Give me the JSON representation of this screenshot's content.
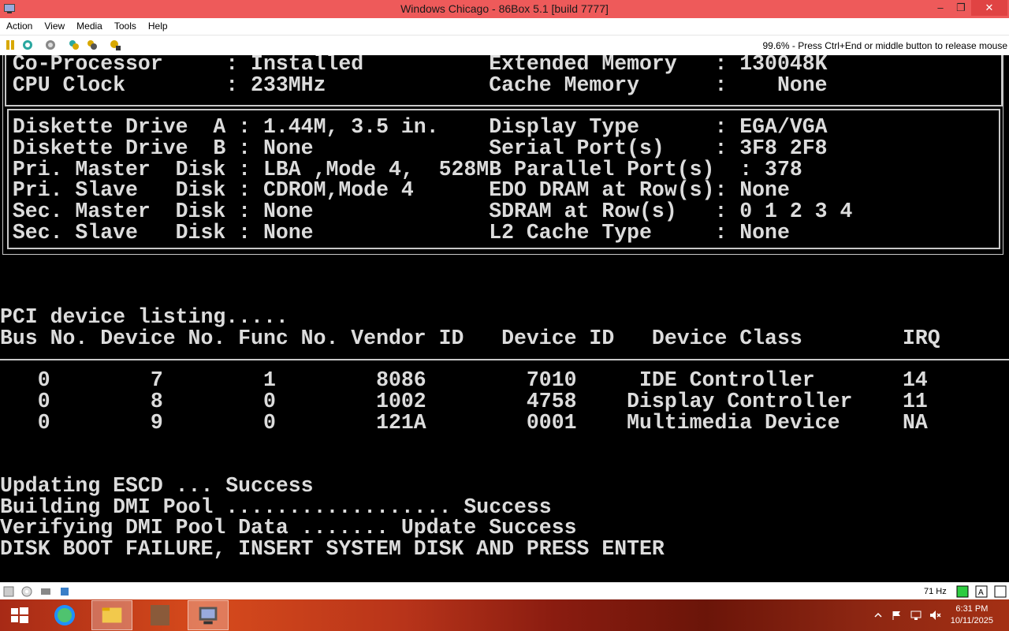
{
  "window": {
    "title": "Windows Chicago - 86Box 5.1 [build 7777]",
    "minimize": "–",
    "restore": "❐",
    "close": "✕"
  },
  "menu": {
    "items": [
      "Action",
      "View",
      "Media",
      "Tools",
      "Help"
    ]
  },
  "toolbar": {
    "buttons": [
      "pause-icon",
      "reset-icon",
      "ctrl-alt-del-icon",
      "settings-icon",
      "hard-reset-icon",
      "screenshot-icon"
    ],
    "hint": "99.6% - Press Ctrl+End or middle button to release mouse"
  },
  "bios": {
    "top_lines": [
      " Co-Processor     : Installed          Extended Memory   : 130048K",
      " CPU Clock        : 233MHz             Cache Memory      :    None"
    ],
    "device_lines": [
      " Diskette Drive  A : 1.44M, 3.5 in.    Display Type      : EGA/VGA",
      " Diskette Drive  B : None              Serial Port(s)    : 3F8 2F8",
      " Pri. Master  Disk : LBA ,Mode 4,  528MB Parallel Port(s)  : 378",
      " Pri. Slave   Disk : CDROM,Mode 4      EDO DRAM at Row(s): None",
      " Sec. Master  Disk : None              SDRAM at Row(s)   : 0 1 2 3 4",
      " Sec. Slave   Disk : None              L2 Cache Type     : None"
    ],
    "pci_title": "PCI device listing.....",
    "pci_header": "Bus No. Device No. Func No. Vendor ID   Device ID   Device Class        IRQ",
    "pci_rows": [
      "   0        7        1        8086        7010     IDE Controller       14",
      "   0        8        0        1002        4758    Display Controller    11",
      "   0        9        0        121A        0001    Multimedia Device     NA"
    ],
    "status_lines": [
      "Updating ESCD ... Success",
      "Building DMI Pool .................. Success",
      "Verifying DMI Pool Data ....... Update Success",
      "DISK BOOT FAILURE, INSERT SYSTEM DISK AND PRESS ENTER"
    ]
  },
  "statusbar": {
    "icons": [
      "floppy-icon",
      "cdrom-icon",
      "network-icon",
      "sound-icon"
    ],
    "refresh": "71 Hz",
    "right_icons": [
      "keyboard-led-icon",
      "caps-icon",
      "display-icon"
    ]
  },
  "taskbar": {
    "items": [
      "start-button",
      "internet-explorer-icon",
      "file-explorer-icon",
      "app-icon",
      "86box-icon"
    ],
    "time": "6:31 PM",
    "date": "10/11/2025",
    "tray": [
      "show-hidden-icon",
      "action-center-icon",
      "network-icon",
      "volume-muted-icon"
    ]
  }
}
